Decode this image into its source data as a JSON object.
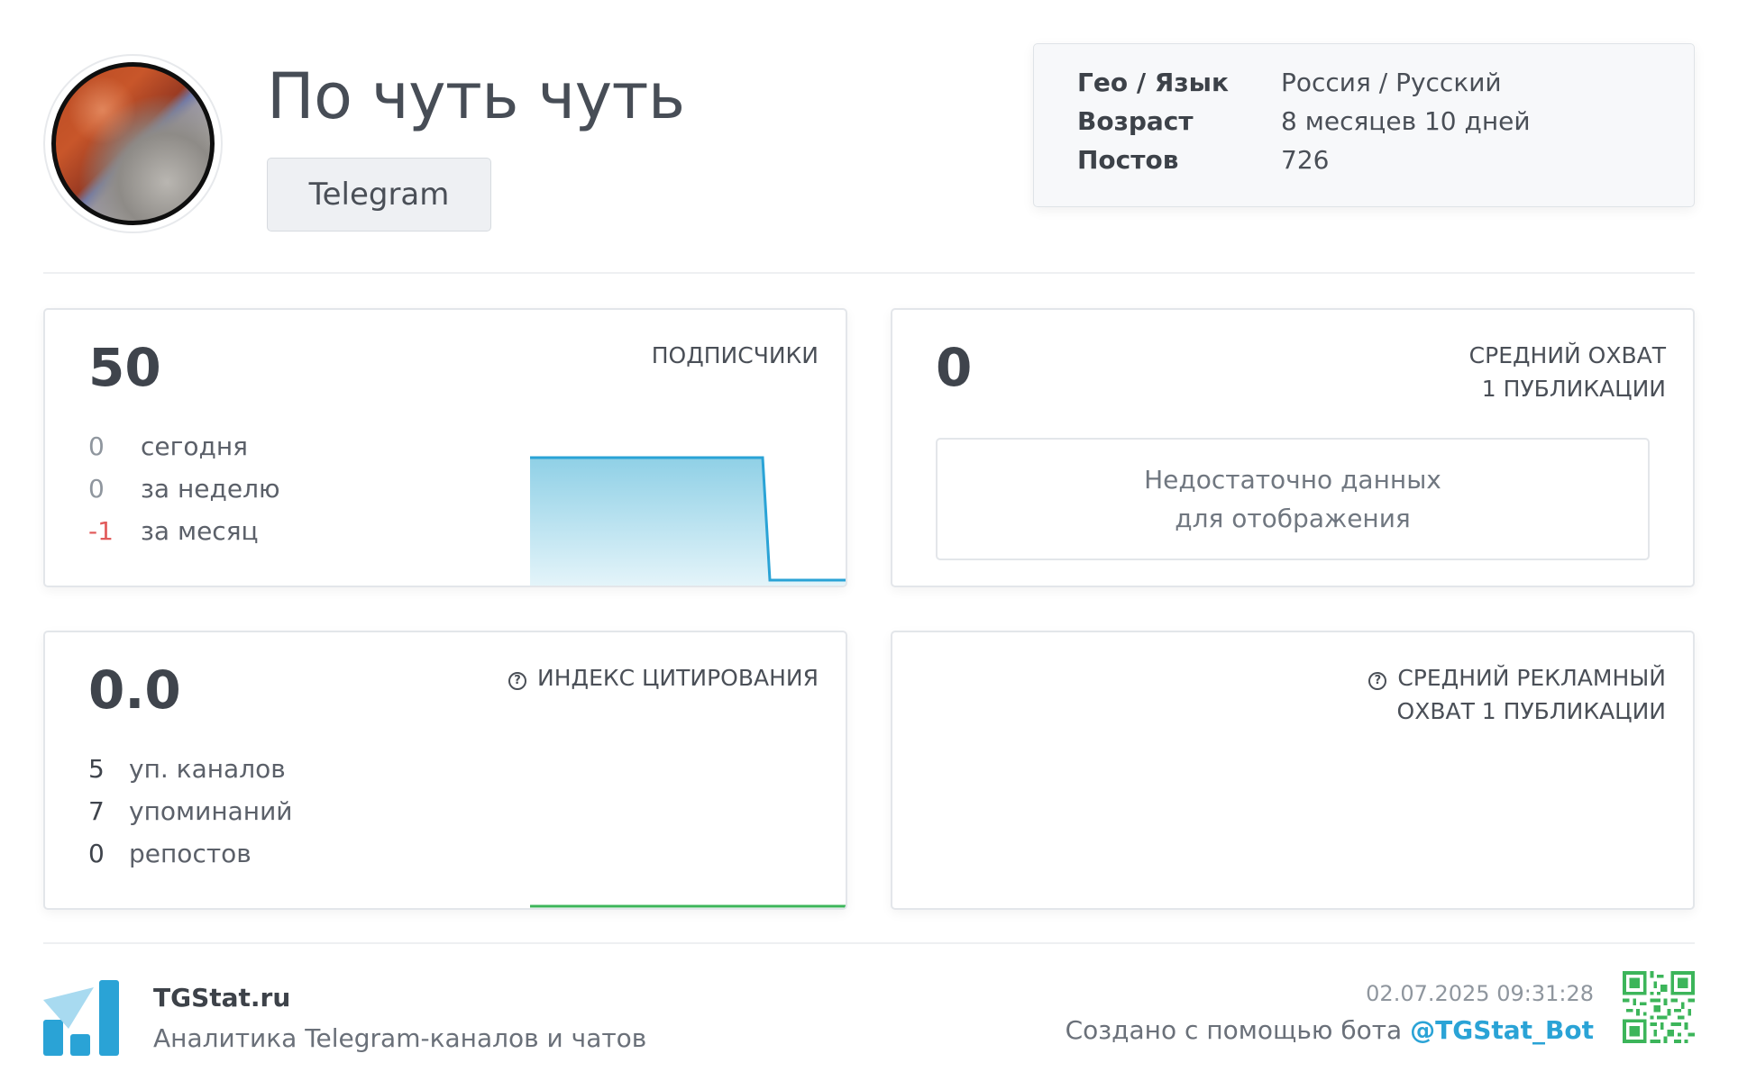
{
  "header": {
    "channel_title": "По чуть чуть",
    "platform": "Telegram"
  },
  "info": [
    {
      "key": "Гео / Язык",
      "value": "Россия / Русский"
    },
    {
      "key": "Возраст",
      "value": "8 месяцев 10 дней"
    },
    {
      "key": "Постов",
      "value": "726"
    }
  ],
  "subscribers": {
    "label": "ПОДПИСЧИКИ",
    "value": "50",
    "today_value": "0",
    "today_label": "сегодня",
    "week_value": "0",
    "week_label": "за неделю",
    "month_value": "-1",
    "month_label": "за месяц",
    "trend_color": "#2aa3d6"
  },
  "reach": {
    "label_line1": "СРЕДНИЙ ОХВАТ",
    "label_line2": "1 ПУБЛИКАЦИИ",
    "value": "0",
    "nodata_line1": "Недостаточно данных",
    "nodata_line2": "для отображения"
  },
  "citation": {
    "label": "ИНДЕКС ЦИТИРОВАНИЯ",
    "value": "0.0",
    "channels_value": "5",
    "channels_label": "уп. каналов",
    "mentions_value": "7",
    "mentions_label": "упоминаний",
    "reposts_value": "0",
    "reposts_label": "репостов",
    "trend_color": "#3cb55a"
  },
  "ad_reach": {
    "label_line1": "СРЕДНИЙ РЕКЛАМНЫЙ",
    "label_line2": "ОХВАТ 1 ПУБЛИКАЦИИ"
  },
  "footer": {
    "brand": "TGStat.ru",
    "tagline": "Аналитика Telegram-каналов и чатов",
    "timestamp": "02.07.2025 09:31:28",
    "created_by": "Создано с помощью бота",
    "bot_handle": "@TGStat_Bot"
  },
  "colors": {
    "accent": "#2aa3d6",
    "negative": "#e15b5b",
    "positive_line": "#3cb55a"
  }
}
